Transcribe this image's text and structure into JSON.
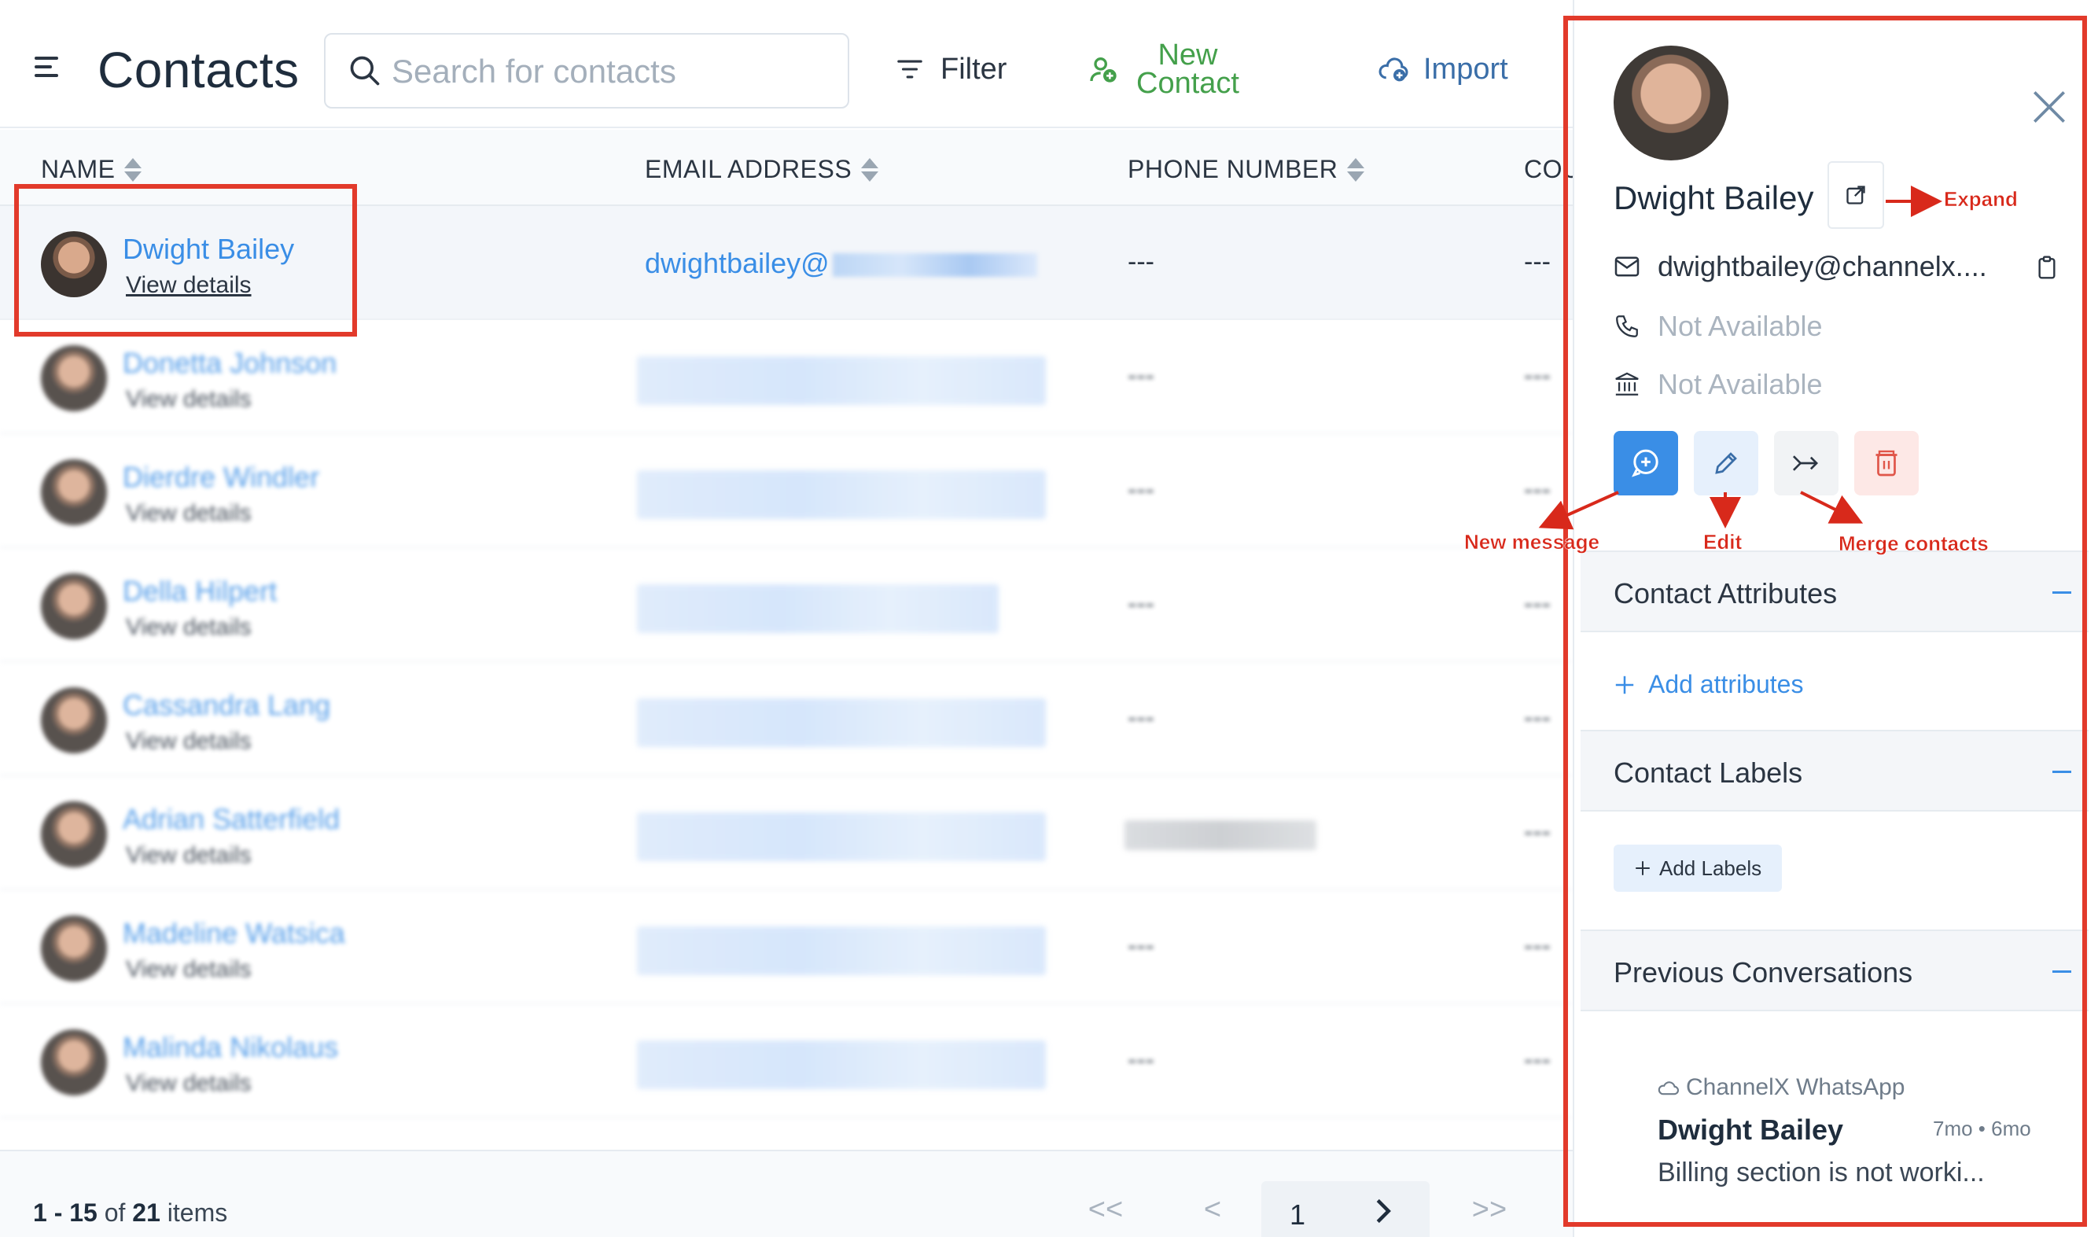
{
  "header": {
    "title": "Contacts",
    "search_placeholder": "Search for contacts",
    "filter_label": "Filter",
    "new_contact_line1": "New",
    "new_contact_line2": "Contact",
    "import_label": "Import"
  },
  "table": {
    "columns": [
      "NAME",
      "EMAIL ADDRESS",
      "PHONE NUMBER",
      "COU"
    ],
    "rows": [
      {
        "name": "Dwight Bailey",
        "view": "View details",
        "email": "dwightbailey@",
        "phone": "---",
        "country": "---",
        "selected": true
      },
      {
        "name": "Donetta Johnson",
        "view": "View details",
        "phone": "---",
        "country": "---"
      },
      {
        "name": "Dierdre Windler",
        "view": "View details",
        "phone": "---",
        "country": "---"
      },
      {
        "name": "Della Hilpert",
        "view": "View details",
        "phone": "---",
        "country": "---"
      },
      {
        "name": "Cassandra Lang",
        "view": "View details",
        "phone": "---",
        "country": "---"
      },
      {
        "name": "Adrian Satterfield",
        "view": "View details",
        "phone": "",
        "country": "---"
      },
      {
        "name": "Madeline Watsica",
        "view": "View details",
        "phone": "---",
        "country": "---"
      },
      {
        "name": "Malinda Nikolaus",
        "view": "View details",
        "phone": "---",
        "country": "---"
      }
    ]
  },
  "pagination": {
    "range": "1 - 15",
    "of": "of",
    "total": "21",
    "items": "items",
    "first": "<<",
    "prev": "<",
    "page": "1",
    "next": ">",
    "last": ">>"
  },
  "panel": {
    "name": "Dwight Bailey",
    "email": "dwightbailey@channelx....",
    "phone": "Not Available",
    "company": "Not Available",
    "sections": {
      "attributes": "Contact Attributes",
      "add_attributes": "Add attributes",
      "labels": "Contact Labels",
      "add_labels": "Add Labels",
      "conversations": "Previous Conversations"
    },
    "conversation": {
      "inbox": "ChannelX WhatsApp",
      "name": "Dwight Bailey",
      "time": "7mo • 6mo",
      "message": "Billing section is not worki..."
    }
  },
  "annotations": {
    "expand": "Expand",
    "new_message": "New message",
    "edit": "Edit",
    "merge": "Merge contacts"
  },
  "colors": {
    "accent": "#3a8ee6",
    "new_contact": "#44a04b",
    "annotation": "#e23a2b"
  }
}
